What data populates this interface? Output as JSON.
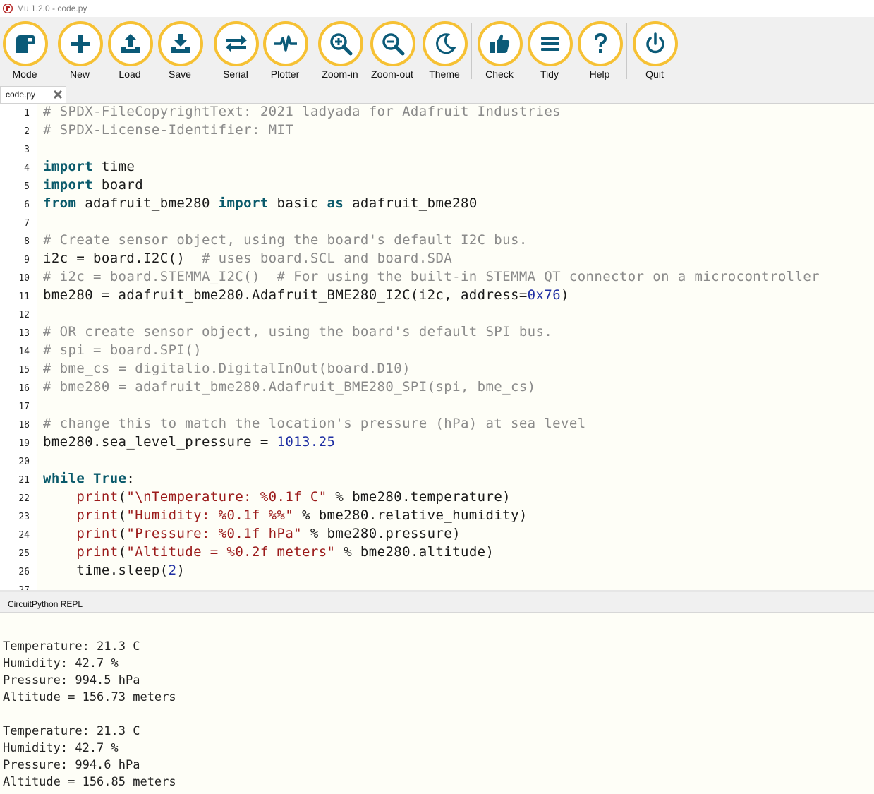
{
  "window": {
    "title": "Mu 1.2.0 - code.py"
  },
  "toolbar": {
    "buttons": [
      {
        "label": "Mode",
        "icon": "mode-icon"
      },
      {
        "label": "New",
        "icon": "plus-icon"
      },
      {
        "label": "Load",
        "icon": "upload-icon"
      },
      {
        "label": "Save",
        "icon": "download-icon"
      },
      {
        "label": "Serial",
        "icon": "swap-arrows-icon"
      },
      {
        "label": "Plotter",
        "icon": "pulse-icon"
      },
      {
        "label": "Zoom-in",
        "icon": "zoom-in-icon"
      },
      {
        "label": "Zoom-out",
        "icon": "zoom-out-icon"
      },
      {
        "label": "Theme",
        "icon": "moon-icon"
      },
      {
        "label": "Check",
        "icon": "thumbs-up-icon"
      },
      {
        "label": "Tidy",
        "icon": "lines-icon"
      },
      {
        "label": "Help",
        "icon": "question-icon"
      },
      {
        "label": "Quit",
        "icon": "power-icon"
      }
    ],
    "accent_color": "#f6c134"
  },
  "tabs": [
    {
      "label": "code.py"
    }
  ],
  "editor": {
    "lines": [
      "# SPDX-FileCopyrightText: 2021 ladyada for Adafruit Industries",
      "# SPDX-License-Identifier: MIT",
      "",
      "import time",
      "import board",
      "from adafruit_bme280 import basic as adafruit_bme280",
      "",
      "# Create sensor object, using the board's default I2C bus.",
      "i2c = board.I2C()  # uses board.SCL and board.SDA",
      "# i2c = board.STEMMA_I2C()  # For using the built-in STEMMA QT connector on a microcontroller",
      "bme280 = adafruit_bme280.Adafruit_BME280_I2C(i2c, address=0x76)",
      "",
      "# OR create sensor object, using the board's default SPI bus.",
      "# spi = board.SPI()",
      "# bme_cs = digitalio.DigitalInOut(board.D10)",
      "# bme280 = adafruit_bme280.Adafruit_BME280_SPI(spi, bme_cs)",
      "",
      "# change this to match the location's pressure (hPa) at sea level",
      "bme280.sea_level_pressure = 1013.25",
      "",
      "while True:",
      "    print(\"\\nTemperature: %0.1f C\" % bme280.temperature)",
      "    print(\"Humidity: %0.1f %%\" % bme280.relative_humidity)",
      "    print(\"Pressure: %0.1f hPa\" % bme280.pressure)",
      "    print(\"Altitude = %0.2f meters\" % bme280.altitude)",
      "    time.sleep(2)",
      ""
    ]
  },
  "repl": {
    "title": "CircuitPython REPL",
    "lines": [
      "",
      "Temperature: 21.3 C",
      "Humidity: 42.7 %",
      "Pressure: 994.5 hPa",
      "Altitude = 156.73 meters",
      "",
      "Temperature: 21.3 C",
      "Humidity: 42.7 %",
      "Pressure: 994.6 hPa",
      "Altitude = 156.85 meters"
    ]
  }
}
